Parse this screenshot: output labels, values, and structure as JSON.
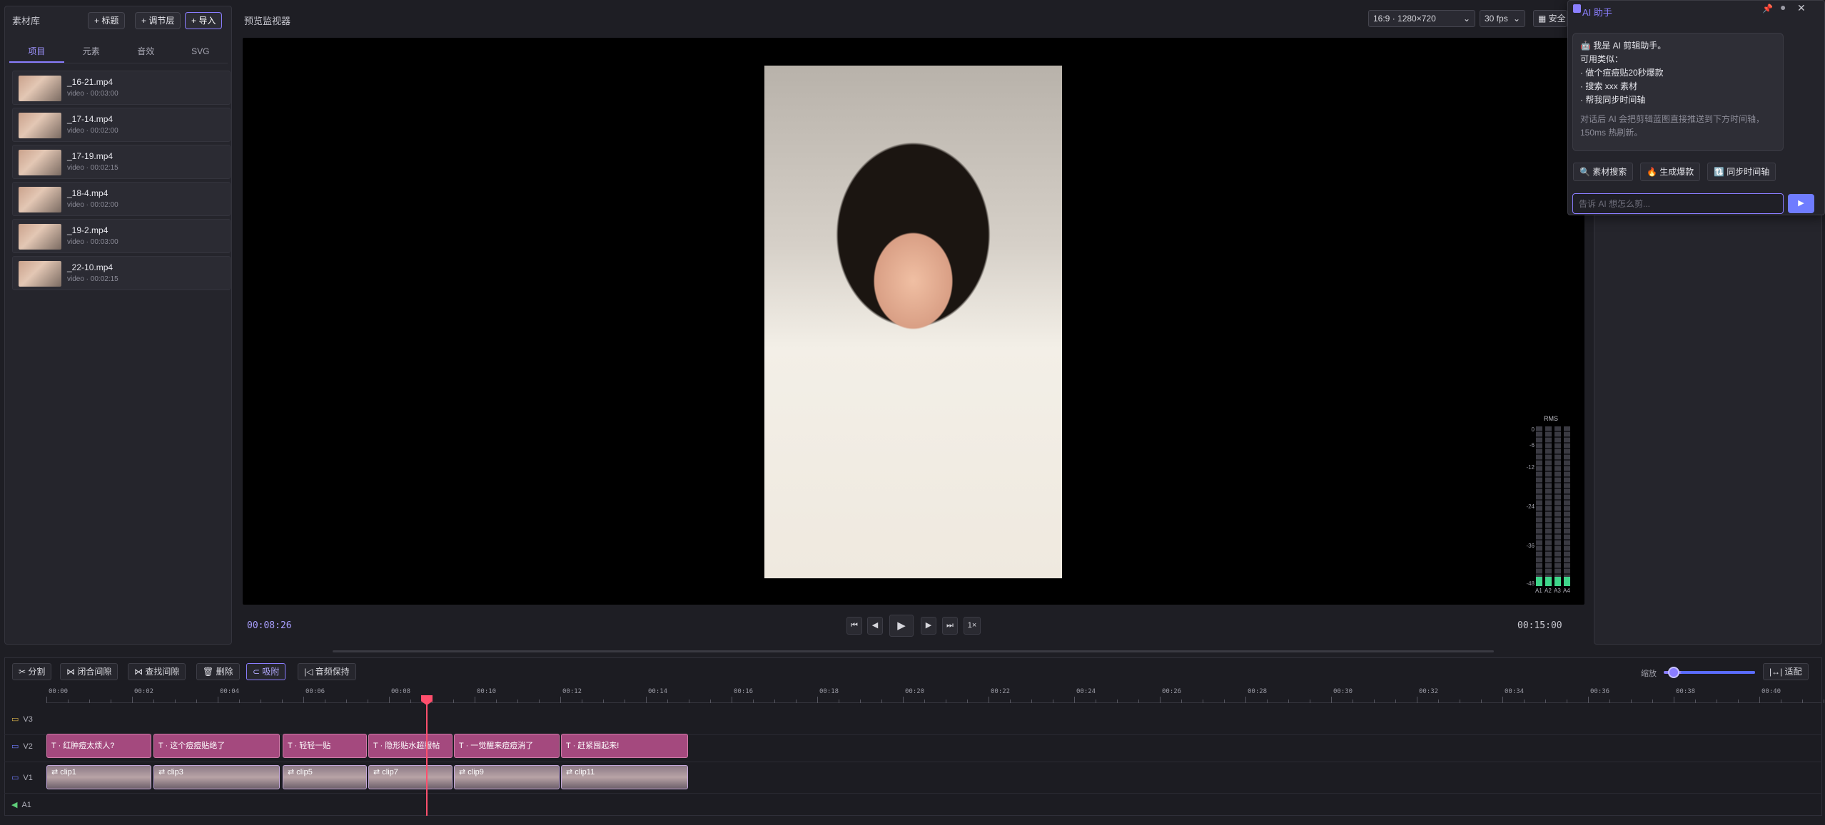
{
  "asset_panel": {
    "title": "素材库",
    "buttons": {
      "title": "+ 标题",
      "adjust_layer": "+ 调节层",
      "import": "+ 导入"
    },
    "tabs": [
      "项目",
      "元素",
      "音效",
      "SVG"
    ],
    "items": [
      {
        "name": "_16-21.mp4",
        "meta": "video · 00:03:00"
      },
      {
        "name": "_17-14.mp4",
        "meta": "video · 00:02:00"
      },
      {
        "name": "_17-19.mp4",
        "meta": "video · 00:02:15"
      },
      {
        "name": "_18-4.mp4",
        "meta": "video · 00:02:00"
      },
      {
        "name": "_19-2.mp4",
        "meta": "video · 00:03:00"
      },
      {
        "name": "_22-10.mp4",
        "meta": "video · 00:02:15"
      }
    ]
  },
  "preview": {
    "title": "预览监视器",
    "aspect": "16:9 · 1280×720",
    "fps": "30 fps",
    "safe_label": "▦ 安全",
    "timecode_current": "00:08:26",
    "timecode_total": "00:15:00",
    "controls": {
      "start": "⏮",
      "prev": "◀",
      "play": "▶",
      "next": "▶",
      "end": "⏭",
      "speed": "1×"
    },
    "meter": {
      "label": "RMS",
      "scale": [
        "0",
        "-6",
        "-12",
        "-24",
        "-36",
        "-48"
      ],
      "channels": [
        "A1",
        "A2",
        "A3",
        "A4"
      ],
      "levels": [
        0.06,
        0.06,
        0.06,
        0.06
      ]
    }
  },
  "ai": {
    "title": "AI 助手",
    "pin_icon": "pin-icon",
    "greeting": "🤖 我是 AI 剪辑助手。",
    "lines": [
      "可用类似：",
      "· 做个痘痘贴20秒爆款",
      "· 搜索 xxx 素材",
      "· 帮我同步时间轴"
    ],
    "note": "对话后 AI 会把剪辑蓝图直接推送到下方时间轴，150ms 热刷新。",
    "chips": [
      "🔍 素材搜索",
      "🔥 生成爆款",
      "🔃 同步时间轴"
    ],
    "input_placeholder": "告诉 AI 想怎么剪...",
    "send": "▶",
    "accent": "#8a7dff"
  },
  "toolbar": {
    "split": "✂ 分割",
    "close_gap": "⋈ 闭合间隙",
    "find_gap": "⋈ 查找间隙",
    "delete": "🗑 删除",
    "snap": "⊂ 吸附",
    "keep_audio": "|◁ 音频保持",
    "zoom_label": "缩放",
    "fit": "|↔| 适配",
    "zoom_level": 0.05
  },
  "ruler": [
    "00:00",
    "00:02",
    "00:04",
    "00:06",
    "00:08",
    "00:10",
    "00:12",
    "00:14",
    "00:16",
    "00:18",
    "00:20",
    "00:22",
    "00:24",
    "00:26",
    "00:28",
    "00:30",
    "00:32",
    "00:34",
    "00:36",
    "00:38",
    "00:40"
  ],
  "tracks": [
    "V3",
    "V2",
    "V1",
    "A1"
  ],
  "text_clips": [
    "T · 红肿痘太烦人?",
    "T · 这个痘痘贴绝了",
    "T · 轻轻一贴",
    "T · 隐形贴水超服帖",
    "T · 一觉醒来痘痘消了",
    "T · 赶紧囤起来!"
  ],
  "video_clips": [
    "⇄ clip1",
    "⇄ clip3",
    "⇄ clip5",
    "⇄ clip7",
    "⇄ clip9",
    "⇄ clip11"
  ],
  "colors": {
    "playhead": "#ff4f6d",
    "text_clip": "#a4497e",
    "meter": "#3fd58a"
  }
}
